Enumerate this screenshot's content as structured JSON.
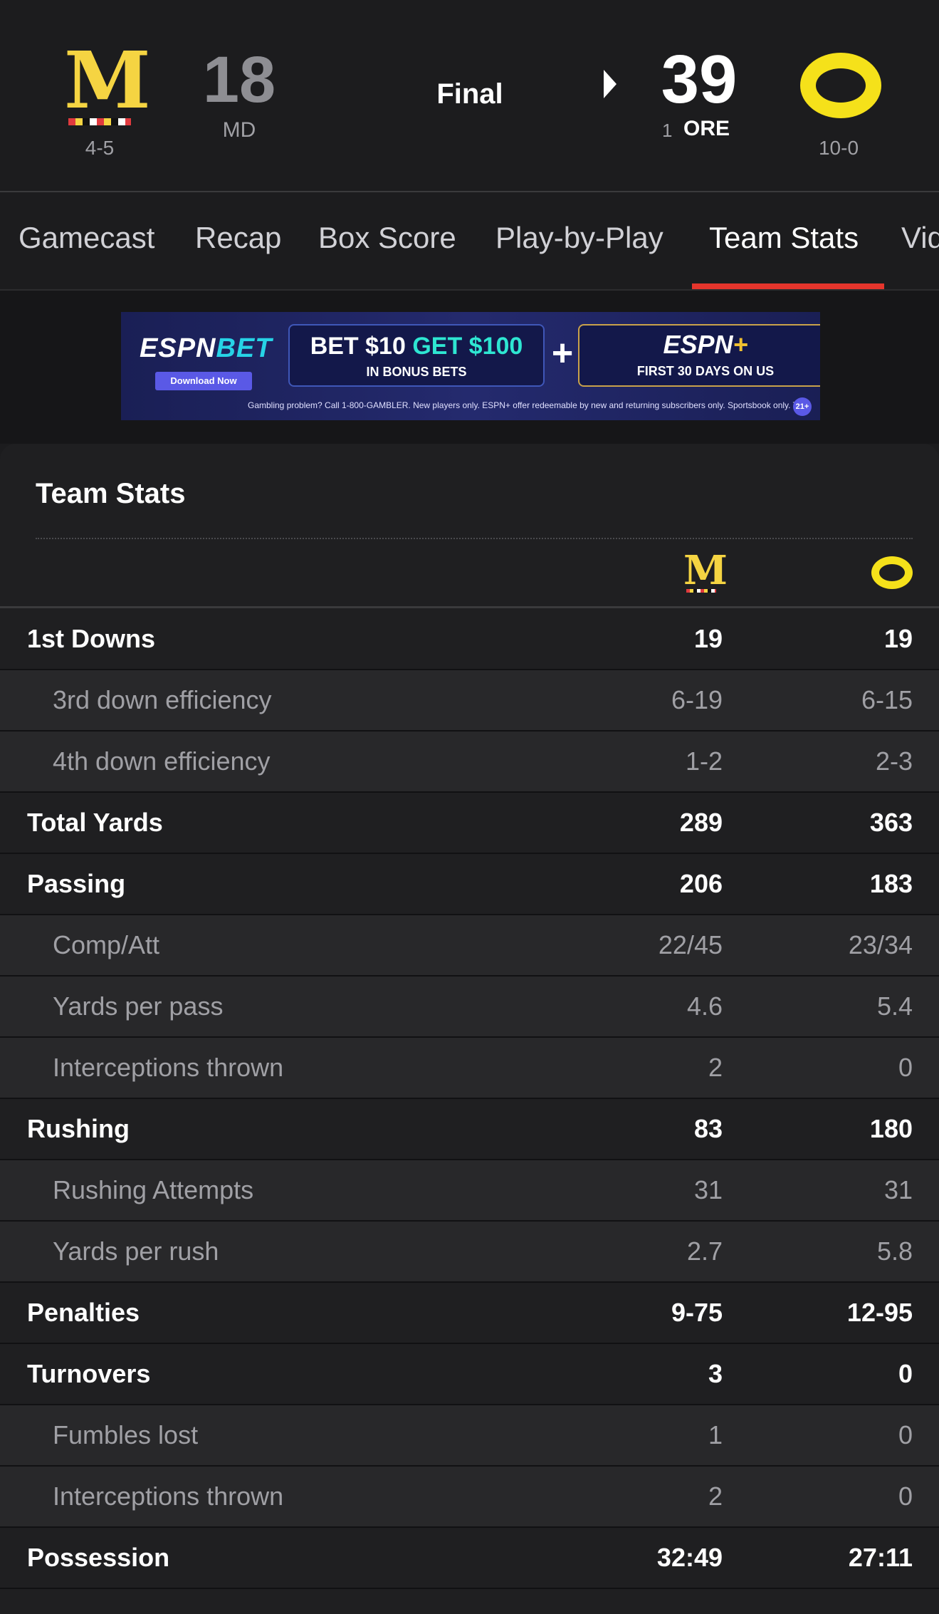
{
  "game": {
    "away": {
      "abbr": "MD",
      "record": "4-5",
      "score": "18",
      "logo": "maryland-m-logo"
    },
    "home": {
      "abbr": "ORE",
      "rank": "1",
      "record": "10-0",
      "score": "39",
      "logo": "oregon-o-logo"
    },
    "status": "Final"
  },
  "tabs": [
    {
      "label": "Gamecast"
    },
    {
      "label": "Recap"
    },
    {
      "label": "Box Score"
    },
    {
      "label": "Play-by-Play"
    },
    {
      "label": "Team Stats",
      "active": true
    },
    {
      "label": "Vid"
    }
  ],
  "ad": {
    "brand_a": "ESPN",
    "brand_b": "BET",
    "download": "Download Now",
    "offer_a": "BET $10",
    "offer_b": "GET $100",
    "offer_sub": "IN BONUS BETS",
    "plus": "+",
    "espn_plus_a": "ESPN",
    "espn_plus_b": "+",
    "espn_plus_sub": "FIRST 30 DAYS ON US",
    "fine_print": "Gambling problem? Call 1-800-GAMBLER. New players only. ESPN+ offer redeemable by new and returning subscribers only. Sportsbook only. Terms apply.",
    "age": "21+"
  },
  "team_stats": {
    "title": "Team Stats",
    "rows": [
      {
        "label": "1st Downs",
        "md": "19",
        "ore": "19",
        "type": "main"
      },
      {
        "label": "3rd down efficiency",
        "md": "6-19",
        "ore": "6-15",
        "type": "sub"
      },
      {
        "label": "4th down efficiency",
        "md": "1-2",
        "ore": "2-3",
        "type": "sub"
      },
      {
        "label": "Total Yards",
        "md": "289",
        "ore": "363",
        "type": "main"
      },
      {
        "label": "Passing",
        "md": "206",
        "ore": "183",
        "type": "main"
      },
      {
        "label": "Comp/Att",
        "md": "22/45",
        "ore": "23/34",
        "type": "sub"
      },
      {
        "label": "Yards per pass",
        "md": "4.6",
        "ore": "5.4",
        "type": "sub"
      },
      {
        "label": "Interceptions thrown",
        "md": "2",
        "ore": "0",
        "type": "sub"
      },
      {
        "label": "Rushing",
        "md": "83",
        "ore": "180",
        "type": "main"
      },
      {
        "label": "Rushing Attempts",
        "md": "31",
        "ore": "31",
        "type": "sub"
      },
      {
        "label": "Yards per rush",
        "md": "2.7",
        "ore": "5.8",
        "type": "sub"
      },
      {
        "label": "Penalties",
        "md": "9-75",
        "ore": "12-95",
        "type": "main"
      },
      {
        "label": "Turnovers",
        "md": "3",
        "ore": "0",
        "type": "main"
      },
      {
        "label": "Fumbles lost",
        "md": "1",
        "ore": "0",
        "type": "sub"
      },
      {
        "label": "Interceptions thrown",
        "md": "2",
        "ore": "0",
        "type": "sub"
      },
      {
        "label": "Possession",
        "md": "32:49",
        "ore": "27:11",
        "type": "main"
      }
    ]
  },
  "colors": {
    "background": "#1c1c1e",
    "accent_red": "#e5352c",
    "maryland_gold": "#f5d442",
    "oregon_yellow": "#f5e11a"
  }
}
